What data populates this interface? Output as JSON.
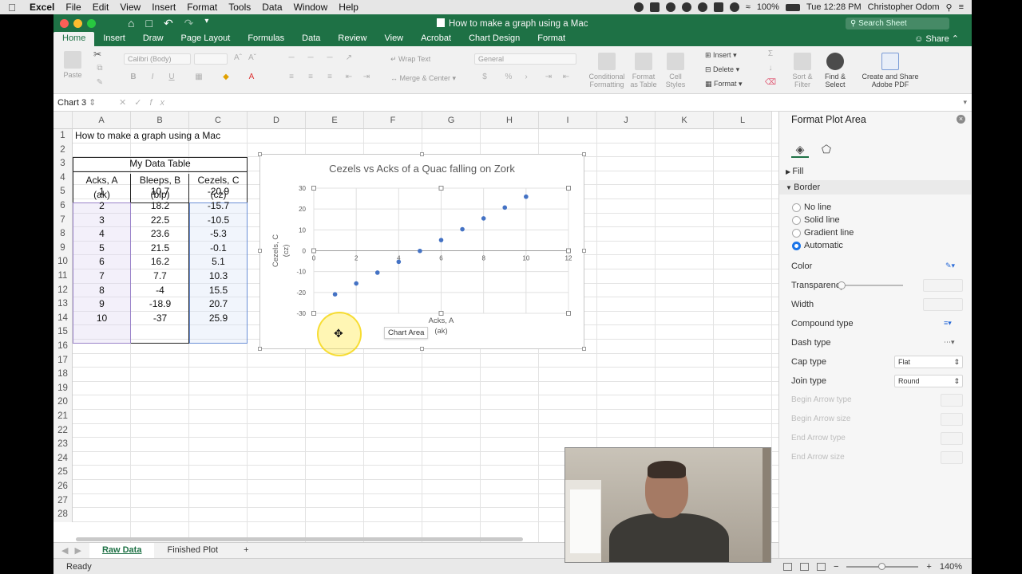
{
  "menubar": {
    "app": "Excel",
    "items": [
      "File",
      "Edit",
      "View",
      "Insert",
      "Format",
      "Tools",
      "Data",
      "Window",
      "Help"
    ],
    "battery": "100%",
    "clock": "Tue 12:28 PM",
    "user": "Christopher Odom"
  },
  "window": {
    "title": "How to make a graph using a Mac",
    "search_placeholder": "Search Sheet",
    "share": "Share"
  },
  "ribbon": {
    "tabs": [
      "Home",
      "Insert",
      "Draw",
      "Page Layout",
      "Formulas",
      "Data",
      "Review",
      "View",
      "Acrobat",
      "Chart Design",
      "Format"
    ],
    "active_tab": "Home",
    "paste": "Paste",
    "font_name": "Calibri (Body)",
    "wrap_text": "Wrap Text",
    "merge_center": "Merge & Center",
    "number_format": "General",
    "conditional_formatting": "Conditional\nFormatting",
    "format_as_table": "Format\nas Table",
    "cell_styles": "Cell\nStyles",
    "insert": "Insert",
    "delete": "Delete",
    "format": "Format",
    "sort_filter": "Sort &\nFilter",
    "find_select": "Find &\nSelect",
    "create_share_pdf": "Create and Share\nAdobe PDF"
  },
  "formula_bar": {
    "name_box": "Chart 3",
    "fx": "fx"
  },
  "sheet": {
    "columns": [
      "A",
      "B",
      "C",
      "D",
      "E",
      "F",
      "G",
      "H",
      "I",
      "J",
      "K",
      "L"
    ],
    "rows": [
      "1",
      "2",
      "3",
      "4",
      "5",
      "6",
      "7",
      "8",
      "9",
      "10",
      "11",
      "12",
      "13",
      "14",
      "15",
      "16",
      "17",
      "18",
      "19",
      "20",
      "21",
      "22",
      "23",
      "24",
      "25",
      "26",
      "27",
      "28"
    ],
    "a1": "How to make a graph using a Mac",
    "table_title": "My Data Table",
    "headers": [
      {
        "line1": "Acks, A",
        "line2": "(ak)"
      },
      {
        "line1": "Bleeps, B",
        "line2": "(blp)"
      },
      {
        "line1": "Cezels, C",
        "line2": "(cz)"
      }
    ],
    "data": [
      [
        "1",
        "10.7",
        "-20.9"
      ],
      [
        "2",
        "18.2",
        "-15.7"
      ],
      [
        "3",
        "22.5",
        "-10.5"
      ],
      [
        "4",
        "23.6",
        "-5.3"
      ],
      [
        "5",
        "21.5",
        "-0.1"
      ],
      [
        "6",
        "16.2",
        "5.1"
      ],
      [
        "7",
        "7.7",
        "10.3"
      ],
      [
        "8",
        "-4",
        "15.5"
      ],
      [
        "9",
        "-18.9",
        "20.7"
      ],
      [
        "10",
        "-37",
        "25.9"
      ]
    ]
  },
  "chart_data": {
    "type": "scatter",
    "title": "Cezels vs Acks of a Quac falling on Zork",
    "xlabel": "Acks, A\n(ak)",
    "ylabel": "Cezels, C\n(cz)",
    "x": [
      1,
      2,
      3,
      4,
      5,
      6,
      7,
      8,
      9,
      10
    ],
    "y": [
      -20.9,
      -15.7,
      -10.5,
      -5.3,
      -0.1,
      5.1,
      10.3,
      15.5,
      20.7,
      25.9
    ],
    "xlim": [
      0,
      12
    ],
    "ylim": [
      -30,
      30
    ],
    "xticks": [
      "0",
      "2",
      "4",
      "6",
      "8",
      "10",
      "12"
    ],
    "yticks": [
      "30",
      "20",
      "10",
      "0",
      "-10",
      "-20",
      "-30"
    ],
    "grid": true,
    "marker_color": "#4472c4"
  },
  "chart_tooltip": "Chart Area",
  "sheet_tabs": [
    "Raw Data",
    "Finished Plot"
  ],
  "active_sheet": "Raw Data",
  "add_sheet": "+",
  "status": {
    "ready": "Ready",
    "zoom": "140%",
    "zoom_minus": "−",
    "zoom_plus": "+"
  },
  "pane": {
    "title": "Format Plot Area",
    "fill": "Fill",
    "border": "Border",
    "options": [
      "No line",
      "Solid line",
      "Gradient line",
      "Automatic"
    ],
    "selected_option": "Automatic",
    "color": "Color",
    "transparency": "Transparency",
    "width": "Width",
    "compound_type": "Compound type",
    "dash_type": "Dash type",
    "cap_type": "Cap type",
    "cap_type_value": "Flat",
    "join_type": "Join type",
    "join_type_value": "Round",
    "begin_arrow_type": "Begin Arrow type",
    "begin_arrow_size": "Begin Arrow size",
    "end_arrow_type": "End Arrow type",
    "end_arrow_size": "End Arrow size"
  },
  "colors": {
    "excel_green": "#1e7145",
    "marker": "#4472c4"
  }
}
